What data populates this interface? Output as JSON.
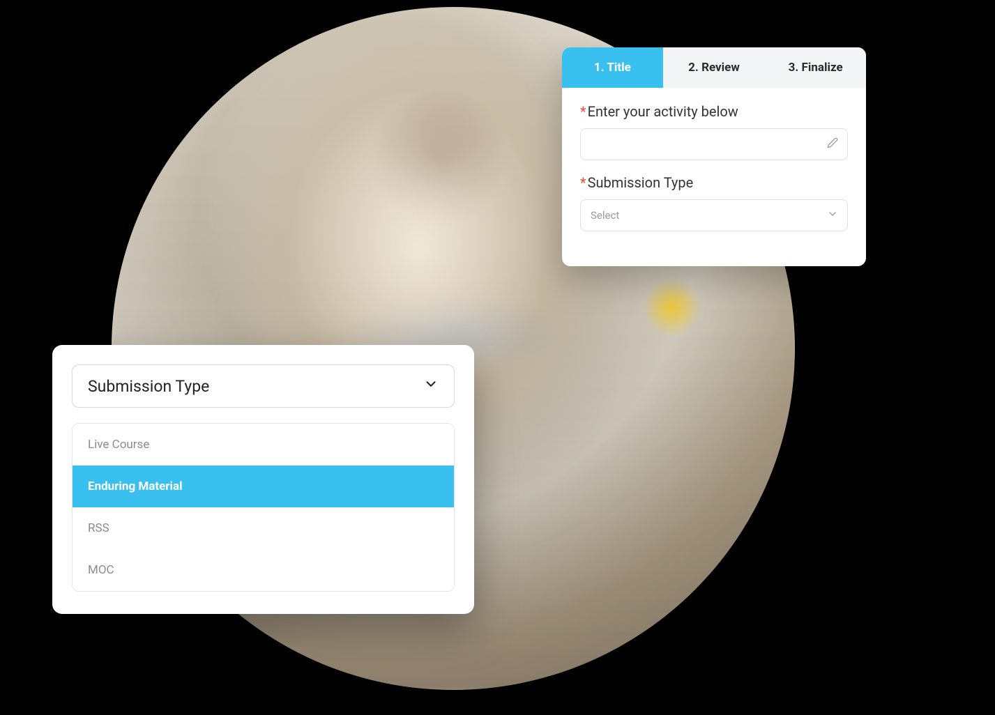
{
  "colors": {
    "accent": "#3ac0ee",
    "required": "#ff4b2b"
  },
  "formCard": {
    "tabs": [
      {
        "label": "1. Title",
        "active": true
      },
      {
        "label": "2. Review",
        "active": false
      },
      {
        "label": "3. Finalize",
        "active": false
      }
    ],
    "fields": {
      "activity": {
        "label": "Enter your activity below",
        "value": "",
        "required": true
      },
      "submissionType": {
        "label": "Submission Type",
        "placeholder": "Select",
        "required": true
      }
    }
  },
  "dropdownCard": {
    "triggerLabel": "Submission Type",
    "options": [
      {
        "label": "Live Course",
        "selected": false
      },
      {
        "label": "Enduring Material",
        "selected": true
      },
      {
        "label": "RSS",
        "selected": false
      },
      {
        "label": "MOC",
        "selected": false
      }
    ]
  }
}
